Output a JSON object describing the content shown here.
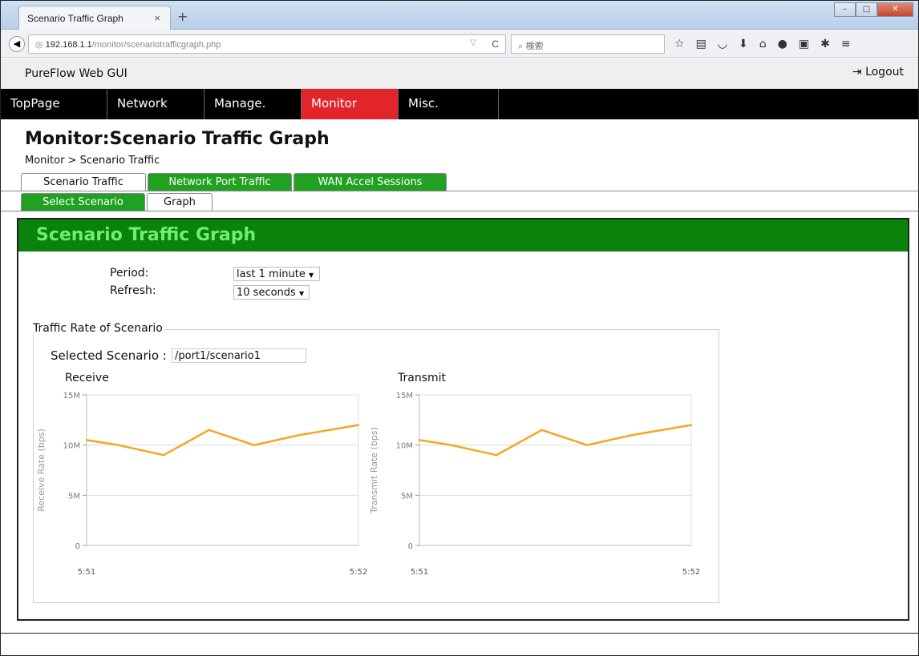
{
  "browser": {
    "tab_title": "Scenario Traffic Graph",
    "url_host": "192.168.1.1",
    "url_path": "/monitor/scenariotrafficgraph.php",
    "search_placeholder": "検索"
  },
  "app": {
    "title": "PureFlow Web GUI",
    "logout": "Logout"
  },
  "menu": [
    {
      "label": "TopPage",
      "active": false
    },
    {
      "label": "Network",
      "active": false
    },
    {
      "label": "Manage.",
      "active": false
    },
    {
      "label": "Monitor",
      "active": true
    },
    {
      "label": "Misc.",
      "active": false
    }
  ],
  "page": {
    "title": "Monitor:Scenario Traffic Graph",
    "breadcrumb": "Monitor > Scenario Traffic"
  },
  "tabs": [
    {
      "label": "Scenario Traffic",
      "active": true
    },
    {
      "label": "Network Port Traffic",
      "active": false
    },
    {
      "label": "WAN Accel Sessions",
      "active": false
    }
  ],
  "subtabs": [
    {
      "label": "Select Scenario",
      "active": false
    },
    {
      "label": "Graph",
      "active": true
    }
  ],
  "panel": {
    "title": "Scenario Traffic Graph",
    "period_label": "Period:",
    "period_value": "last 1 minute",
    "refresh_label": "Refresh:",
    "refresh_value": "10 seconds",
    "group_legend": "Traffic Rate of Scenario",
    "selected_label": "Selected Scenario :",
    "selected_value": "/port1/scenario1"
  },
  "colors": {
    "accent_green": "#0b820b",
    "menu_active": "#e1252a",
    "line": "#f5a623"
  },
  "chart_data": [
    {
      "type": "line",
      "title": "Receive",
      "ylabel": "Receive Rate (bps)",
      "ylim": [
        0,
        15000000
      ],
      "yticks": [
        "0",
        "5M",
        "10M",
        "15M"
      ],
      "xticks": [
        "5:51",
        "5:52"
      ],
      "x": [
        "5:51:00",
        "5:51:07",
        "5:51:17",
        "5:51:27",
        "5:51:37",
        "5:51:47",
        "5:52:00"
      ],
      "values": [
        10500000,
        10000000,
        9000000,
        11500000,
        10000000,
        11000000,
        12000000
      ],
      "grid": true
    },
    {
      "type": "line",
      "title": "Transmit",
      "ylabel": "Transmit Rate (bps)",
      "ylim": [
        0,
        15000000
      ],
      "yticks": [
        "0",
        "5M",
        "10M",
        "15M"
      ],
      "xticks": [
        "5:51",
        "5:52"
      ],
      "x": [
        "5:51:00",
        "5:51:07",
        "5:51:17",
        "5:51:27",
        "5:51:37",
        "5:51:47",
        "5:52:00"
      ],
      "values": [
        10500000,
        10000000,
        9000000,
        11500000,
        10000000,
        11000000,
        12000000
      ],
      "grid": true
    }
  ]
}
